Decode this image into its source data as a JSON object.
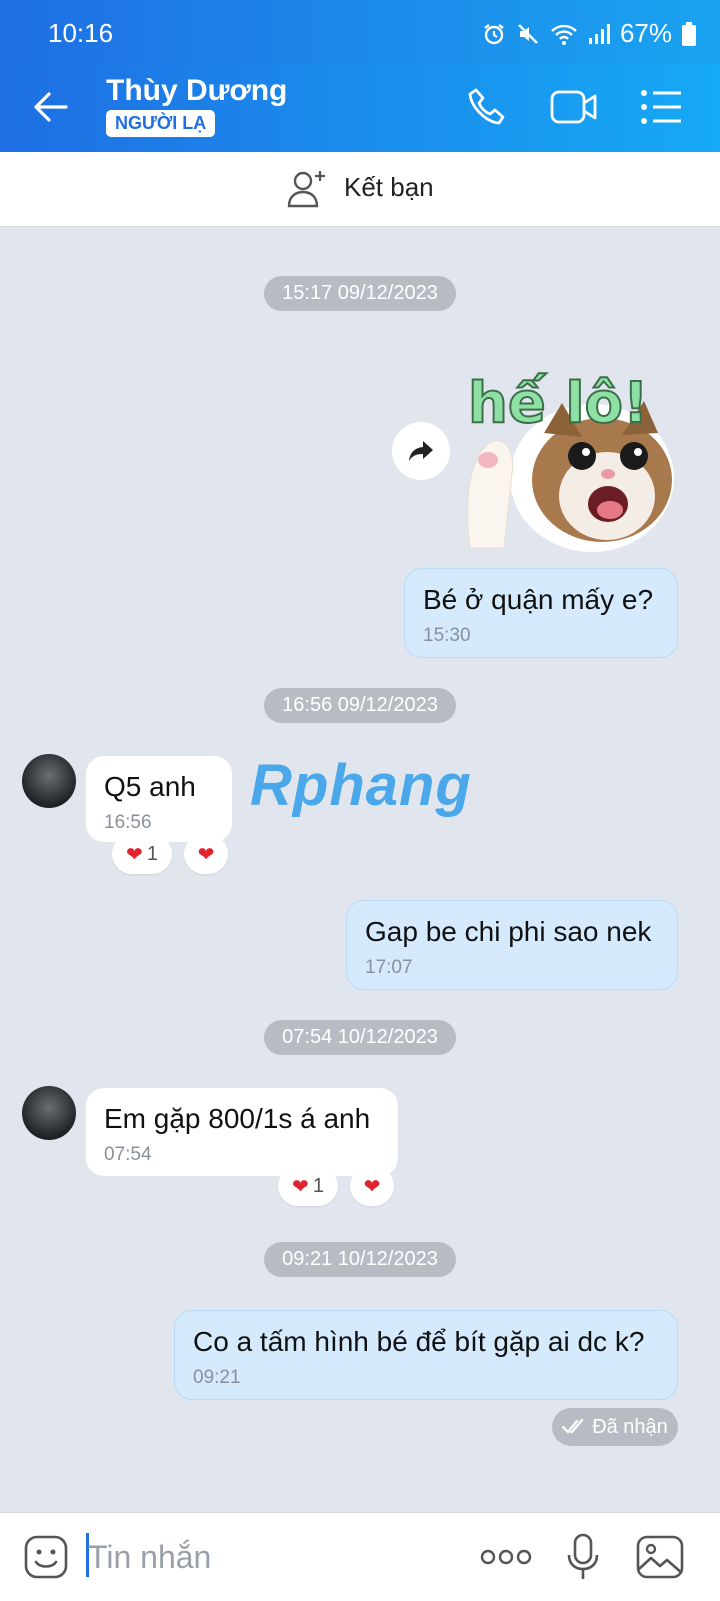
{
  "status_bar": {
    "time": "10:16",
    "battery": "67%"
  },
  "header": {
    "contact_name": "Thùy Dương",
    "badge": "NGƯỜI LẠ"
  },
  "add_friend": {
    "label": "Kết bạn"
  },
  "sticker": {
    "text": "hế lô!"
  },
  "watermark": "Rphang",
  "timestamps": [
    "15:17 09/12/2023",
    "16:56 09/12/2023",
    "07:54 10/12/2023",
    "09:21 10/12/2023"
  ],
  "messages": [
    {
      "sender": "me",
      "text": "Bé ở quận mấy e?",
      "time": "15:30"
    },
    {
      "sender": "them",
      "text": "Q5 anh",
      "time": "16:56",
      "reaction_count": "1"
    },
    {
      "sender": "me",
      "text": "Gap be chi phi sao nek",
      "time": "17:07"
    },
    {
      "sender": "them",
      "text": "Em gặp 800/1s á anh",
      "time": "07:54",
      "reaction_count": "1"
    },
    {
      "sender": "me",
      "text": "Co a tấm hình bé để bít gặp ai dc k?",
      "time": "09:21"
    }
  ],
  "delivery_status": "Đã nhận",
  "composer": {
    "placeholder": "Tin nhắn"
  },
  "colors": {
    "header_start": "#1f6fe3",
    "header_end": "#16a9f5",
    "my_bubble": "#d5ebfd",
    "chat_bg": "#e1e6ee"
  }
}
